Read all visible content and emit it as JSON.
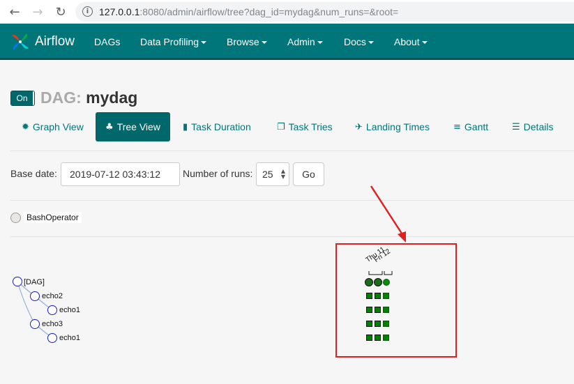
{
  "browser": {
    "url_host": "127.0.0.1",
    "url_rest": ":8080/admin/airflow/tree?dag_id=mydag&num_runs=&root="
  },
  "navbar": {
    "brand": "Airflow",
    "items": [
      {
        "label": "DAGs",
        "dropdown": false
      },
      {
        "label": "Data Profiling",
        "dropdown": true
      },
      {
        "label": "Browse",
        "dropdown": true
      },
      {
        "label": "Admin",
        "dropdown": true
      },
      {
        "label": "Docs",
        "dropdown": true
      },
      {
        "label": "About",
        "dropdown": true
      }
    ]
  },
  "dag": {
    "toggle_label": "On",
    "title_prefix": "DAG:",
    "name": "mydag"
  },
  "tabs": [
    {
      "label": "Graph View",
      "icon": "sun-icon",
      "active": false
    },
    {
      "label": "Tree View",
      "icon": "tree-icon",
      "active": true
    },
    {
      "label": "Task Duration",
      "icon": "bar-chart-icon",
      "active": false
    },
    {
      "label": "Task Tries",
      "icon": "copy-icon",
      "active": false
    },
    {
      "label": "Landing Times",
      "icon": "plane-icon",
      "active": false
    },
    {
      "label": "Gantt",
      "icon": "gantt-icon",
      "active": false
    },
    {
      "label": "Details",
      "icon": "list-icon",
      "active": false
    }
  ],
  "form": {
    "base_date_label": "Base date:",
    "base_date_value": "2019-07-12 03:43:12",
    "num_runs_label": "Number of runs:",
    "num_runs_value": "25",
    "go_label": "Go"
  },
  "legend": {
    "operator": "BashOperator"
  },
  "tree": {
    "nodes": [
      {
        "label": "[DAG]"
      },
      {
        "label": "echo2"
      },
      {
        "label": "echo1"
      },
      {
        "label": "echo3"
      },
      {
        "label": "echo1"
      }
    ],
    "run_header_labels": [
      "Thu 11",
      "Fri 12"
    ]
  },
  "colors": {
    "navbar": "#00767a",
    "accent": "#00676b",
    "success": "#008000",
    "highlight_box": "#e02020"
  }
}
